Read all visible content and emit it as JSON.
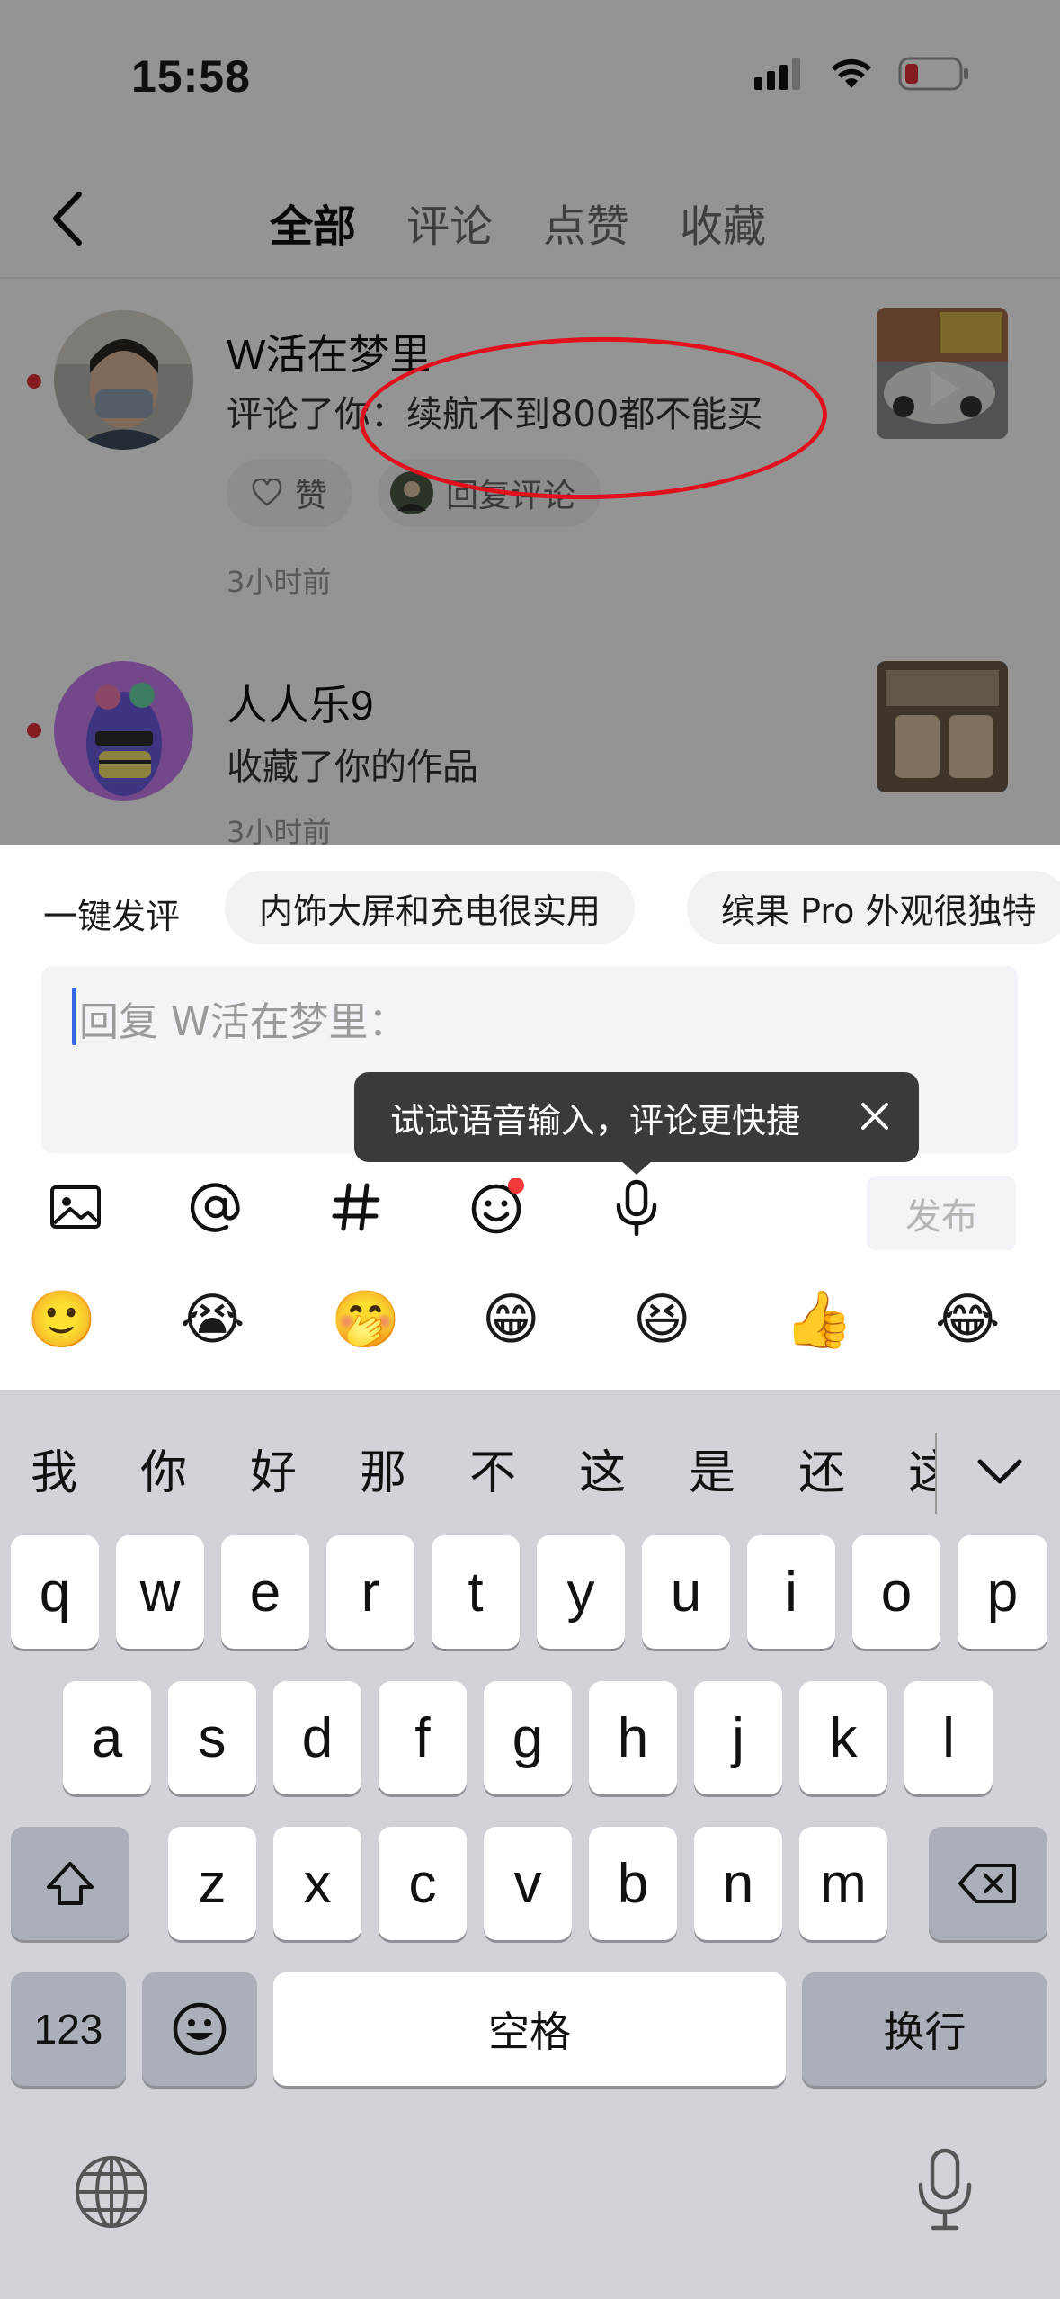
{
  "status_bar": {
    "time": "15:58"
  },
  "header": {
    "tabs": [
      {
        "label": "全部",
        "active": true
      },
      {
        "label": "评论",
        "active": false
      },
      {
        "label": "点赞",
        "active": false
      },
      {
        "label": "收藏",
        "active": false
      }
    ]
  },
  "notifications": [
    {
      "user": "W活在梦里",
      "message": "评论了你：续航不到800都不能买",
      "like_label": "赞",
      "reply_label": "回复评论",
      "time": "3小时前",
      "unread": true
    },
    {
      "user": "人人乐9",
      "message": "收藏了你的作品",
      "time": "3小时前",
      "unread": true
    }
  ],
  "comment_sheet": {
    "quick_label": "一键发评",
    "quick_chips": [
      "内饰大屏和充电很实用",
      "缤果 Pro 外观很独特"
    ],
    "input_placeholder": "回复 W活在梦里：",
    "tooltip": "试试语音输入，评论更快捷",
    "publish_label": "发布",
    "toolbar": [
      "image-icon",
      "at-icon",
      "hashtag-icon",
      "emoji-icon",
      "microphone-icon"
    ],
    "emojis": [
      "🙂",
      "😭",
      "🤭",
      "😁",
      "😆",
      "👍",
      "😂"
    ]
  },
  "keyboard": {
    "candidates": [
      "我",
      "你",
      "好",
      "那",
      "不",
      "这",
      "是",
      "还",
      "这"
    ],
    "row1": [
      "q",
      "w",
      "e",
      "r",
      "t",
      "y",
      "u",
      "i",
      "o",
      "p"
    ],
    "row2": [
      "a",
      "s",
      "d",
      "f",
      "g",
      "h",
      "j",
      "k",
      "l"
    ],
    "row3": [
      "z",
      "x",
      "c",
      "v",
      "b",
      "n",
      "m"
    ],
    "numbers_label": "123",
    "space_label": "空格",
    "return_label": "换行"
  },
  "colors": {
    "annotation_circle": "#e0101c",
    "unread_dot": "#e0313a",
    "caret": "#3a64e6"
  }
}
